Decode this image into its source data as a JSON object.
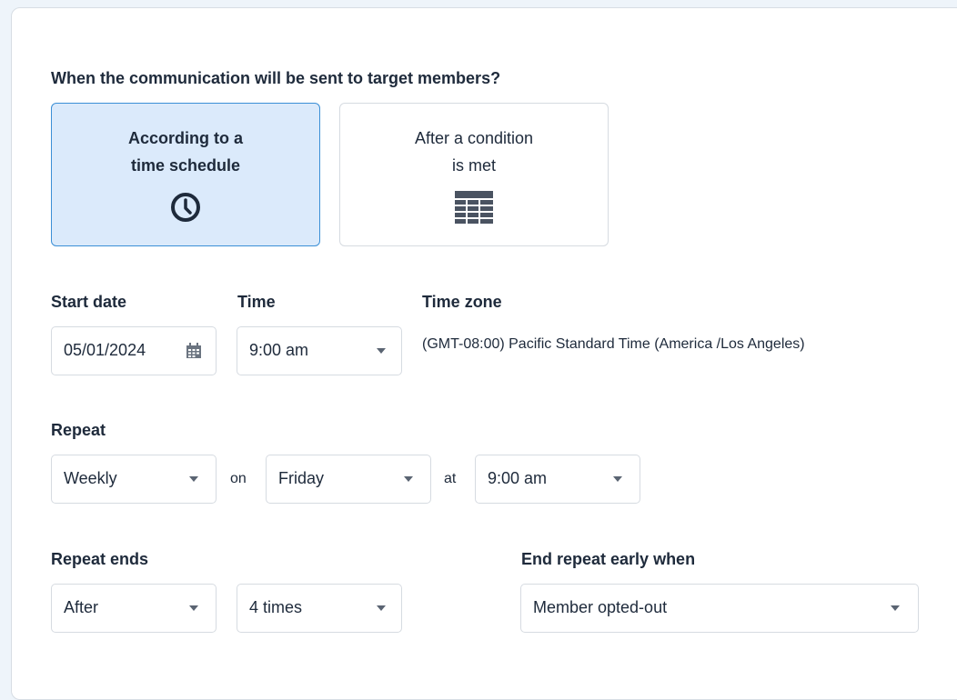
{
  "question": "When the communication will be sent to target members?",
  "options": [
    {
      "line1": "According to a",
      "line2": "time schedule",
      "icon": "clock-icon",
      "selected": true
    },
    {
      "line1": "After a condition",
      "line2": "is met",
      "icon": "table-icon",
      "selected": false
    }
  ],
  "start_date": {
    "label": "Start date",
    "value": "05/01/2024",
    "icon": "calendar-icon"
  },
  "time": {
    "label": "Time",
    "value": "9:00 am"
  },
  "time_zone": {
    "label": "Time zone",
    "value": "(GMT-08:00) Pacific Standard Time (America /Los Angeles)"
  },
  "repeat": {
    "label": "Repeat",
    "frequency": "Weekly",
    "on_label": "on",
    "day": "Friday",
    "at_label": "at",
    "time": "9:00 am"
  },
  "repeat_ends": {
    "label": "Repeat ends",
    "type": "After",
    "count": "4 times"
  },
  "end_early": {
    "label": "End repeat early when",
    "value": "Member opted-out"
  },
  "colors": {
    "accent_border": "#3b8fd6",
    "selected_bg": "#dbeafb",
    "page_bg": "#eef4fa"
  }
}
